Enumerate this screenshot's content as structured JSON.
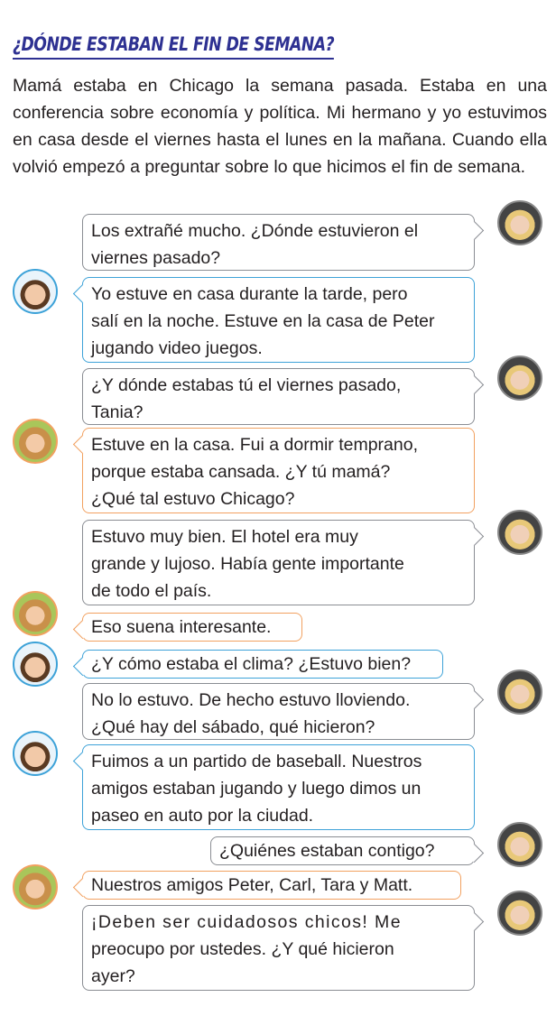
{
  "title": "¿DÓNDE ESTABAN EL FIN DE SEMANA?",
  "intro": "Mamá estaba en Chicago la semana pasada. Estaba en una conferencia sobre economía y política.   Mi hermano y yo estuvimos en casa desde el viernes hasta el lunes en la mañana. Cuando ella volvió empezó a preguntar sobre lo que hicimos el fin de semana.",
  "messages": [
    {
      "speaker": "mom",
      "lines": [
        "Los extrañé mucho. ¿Dónde estuvieron el",
        "viernes pasado?"
      ]
    },
    {
      "speaker": "boy",
      "lines": [
        "Yo estuve en casa durante la tarde, pero",
        "salí en la noche.  Estuve en la casa de Peter",
        "jugando video juegos."
      ]
    },
    {
      "speaker": "mom",
      "lines": [
        "¿Y dónde estabas tú el viernes pasado,",
        "Tania?"
      ]
    },
    {
      "speaker": "girl",
      "lines": [
        "Estuve en la casa. Fui a dormir temprano,",
        "porque estaba cansada. ¿Y tú mamá?",
        "¿Qué tal estuvo Chicago?"
      ]
    },
    {
      "speaker": "mom",
      "lines": [
        "Estuvo muy bien. El hotel era muy",
        "grande y lujoso. Había gente importante",
        "de todo el país."
      ]
    },
    {
      "speaker": "girl",
      "lines": [
        "Eso suena interesante."
      ]
    },
    {
      "speaker": "boy",
      "lines": [
        "¿Y cómo estaba el clima? ¿Estuvo bien?"
      ]
    },
    {
      "speaker": "mom",
      "lines": [
        "No lo estuvo. De hecho estuvo lloviendo.",
        "¿Qué hay del sábado, qué hicieron?"
      ]
    },
    {
      "speaker": "boy",
      "lines": [
        "Fuimos a un partido de baseball. Nuestros",
        "amigos estaban jugando y luego dimos un",
        "paseo en auto por la ciudad."
      ]
    },
    {
      "speaker": "mom",
      "lines": [
        "¿Quiénes estaban contigo?"
      ]
    },
    {
      "speaker": "girl",
      "lines": [
        "Nuestros amigos Peter, Carl, Tara y Matt."
      ]
    },
    {
      "speaker": "mom",
      "lines": [
        "¡Deben ser cuidadosos chicos! Me",
        "preocupo por ustedes. ¿Y qué hicieron",
        "ayer?"
      ]
    }
  ],
  "colors": {
    "title": "#2e3192",
    "mom_border": "#8a8d93",
    "boy_border": "#3da2d8",
    "girl_border": "#f2a160"
  },
  "avatars": {
    "mom": "mom-avatar",
    "boy": "boy-avatar",
    "girl": "girl-avatar"
  }
}
